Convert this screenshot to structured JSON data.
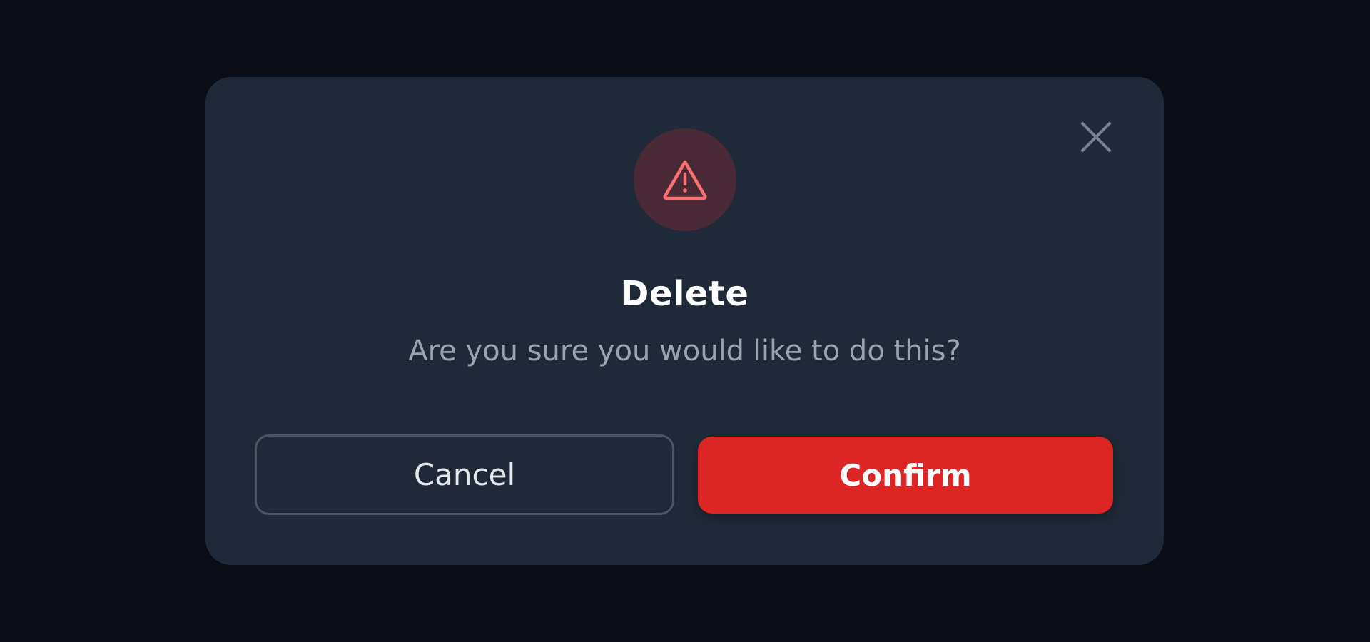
{
  "dialog": {
    "title": "Delete",
    "message": "Are you sure you would like to do this?",
    "cancel_label": "Cancel",
    "confirm_label": "Confirm",
    "icons": {
      "close": "close-icon",
      "warning": "warning-triangle-icon"
    },
    "colors": {
      "backdrop": "#0a0d16",
      "dialog_bg": "#1f2937",
      "danger": "#dc2626",
      "warning_icon": "#f87171",
      "warning_bg": "#4a2a36",
      "muted_text": "#9ca3af"
    }
  }
}
